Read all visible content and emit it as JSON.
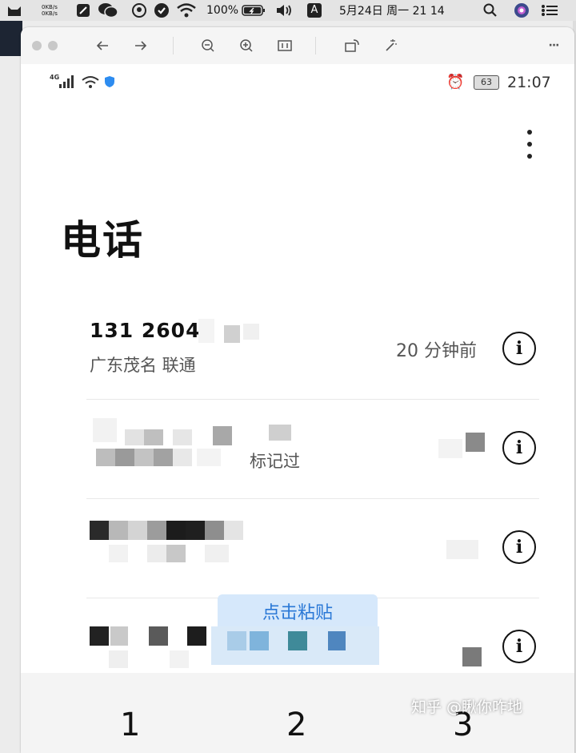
{
  "menubar": {
    "net_up": "0KB/s",
    "net_down": "0KB/s",
    "battery": "100%",
    "input_method": "A",
    "datetime": "5月24日 周一  21 14",
    "icons": [
      "cat-icon",
      "notes-icon",
      "wechat-icon",
      "qq-icon",
      "shield-icon",
      "wifi-icon",
      "battery-icon",
      "volume-icon",
      "input-icon",
      "search-icon",
      "siri-icon",
      "control-center-icon"
    ]
  },
  "viewer": {
    "toolbar": [
      "close-icon",
      "minimize-icon",
      "back-icon",
      "forward-icon",
      "zoom-out-icon",
      "zoom-in-icon",
      "actual-size-icon",
      "rotate-icon",
      "magic-wand-icon",
      "more-icon"
    ],
    "more_label": "···"
  },
  "phone": {
    "status": {
      "signal": "4G",
      "alarm": "⏰",
      "battery_level": "63",
      "time": "21:07"
    },
    "page_title": "电话",
    "calls": [
      {
        "number": "131 2604",
        "location": "广东茂名 联通",
        "time": "20 分钟前",
        "info": "i"
      },
      {
        "number": "",
        "location": "标记过",
        "time": "",
        "info": "i"
      },
      {
        "number": "",
        "location": "",
        "time": "",
        "info": "i"
      },
      {
        "number": "",
        "location": "",
        "time": "",
        "info": "i"
      }
    ],
    "paste_popup": "点击粘贴",
    "dialpad": {
      "digit_1": "1",
      "digit_2": "2",
      "digit_3": "3"
    },
    "watermark": "知乎 @瞅你咋地"
  }
}
